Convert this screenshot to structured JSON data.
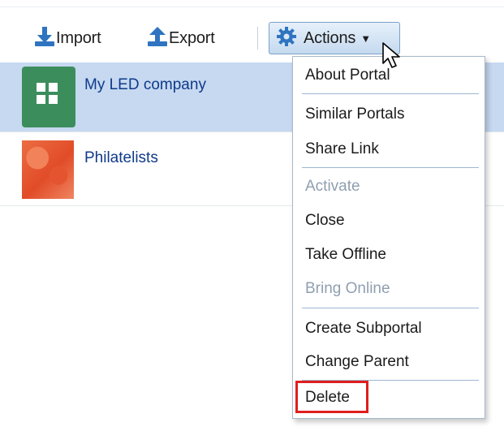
{
  "toolbar": {
    "import_label": "Import",
    "export_label": "Export",
    "actions_label": "Actions"
  },
  "portals": [
    {
      "name": "My LED company",
      "selected": true
    },
    {
      "name": "Philatelists",
      "selected": false
    }
  ],
  "actions_menu": {
    "items": [
      {
        "label": "About Portal",
        "enabled": true
      },
      {
        "label": "Similar Portals",
        "enabled": true
      },
      {
        "label": "Share Link",
        "enabled": true
      },
      {
        "label": "Activate",
        "enabled": false
      },
      {
        "label": "Close",
        "enabled": true
      },
      {
        "label": "Take Offline",
        "enabled": true
      },
      {
        "label": "Bring Online",
        "enabled": false
      },
      {
        "label": "Create Subportal",
        "enabled": true
      },
      {
        "label": "Change Parent",
        "enabled": true
      },
      {
        "label": "Delete",
        "enabled": true,
        "highlighted": true
      }
    ]
  },
  "colors": {
    "accent": "#2f74c0",
    "selected_row": "#c6d9f1",
    "link": "#0f3a8a",
    "highlight_box": "#e01e1e",
    "disabled_text": "#8f9fb0"
  },
  "icons": {
    "import": "download-icon",
    "export": "upload-icon",
    "actions": "gear-icon",
    "caret": "caret-down-icon",
    "cursor": "mouse-pointer-icon"
  }
}
